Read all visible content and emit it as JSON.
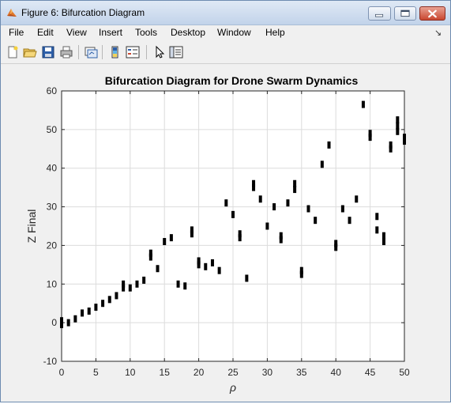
{
  "window": {
    "title": "Figure 6: Bifurcation Diagram",
    "icon": "matlab-figure-icon",
    "title_bar_color": "#c2d3ea",
    "close_color": "#c94730"
  },
  "menu": [
    "File",
    "Edit",
    "View",
    "Insert",
    "Tools",
    "Desktop",
    "Window",
    "Help"
  ],
  "toolbar_icons": [
    "new-figure-icon",
    "open-file-icon",
    "save-icon",
    "print-icon",
    "link-plot-icon",
    "insert-colorbar-icon",
    "insert-legend-icon",
    "edit-plot-arrow-icon",
    "property-editor-icon"
  ],
  "chart_data": {
    "type": "scatter",
    "title": "Bifurcation Diagram for Drone Swarm Dynamics",
    "xlabel": "ρ",
    "ylabel": "Z Final",
    "xlim": [
      0,
      50
    ],
    "ylim": [
      -10,
      60
    ],
    "xticks": [
      "0",
      "5",
      "10",
      "15",
      "20",
      "25",
      "30",
      "35",
      "40",
      "45",
      "50"
    ],
    "yticks": [
      "-10",
      "0",
      "10",
      "20",
      "30",
      "40",
      "50",
      "60"
    ],
    "grid": true,
    "marker": "short vertical dark segments",
    "marker_color": "#000000",
    "points": [
      [
        0,
        -0.5
      ],
      [
        0,
        0.5
      ],
      [
        1,
        0
      ],
      [
        2,
        1
      ],
      [
        3,
        2.5
      ],
      [
        4,
        3
      ],
      [
        5,
        4
      ],
      [
        6,
        5
      ],
      [
        7,
        6
      ],
      [
        8,
        7
      ],
      [
        9,
        9
      ],
      [
        9,
        10
      ],
      [
        10,
        9
      ],
      [
        11,
        10
      ],
      [
        12,
        11
      ],
      [
        13,
        17
      ],
      [
        13,
        18
      ],
      [
        14,
        14
      ],
      [
        15,
        21
      ],
      [
        16,
        22
      ],
      [
        17,
        10
      ],
      [
        18,
        9.5
      ],
      [
        19,
        23
      ],
      [
        19,
        24
      ],
      [
        20,
        15
      ],
      [
        20,
        16
      ],
      [
        21,
        14.5
      ],
      [
        22,
        15.5
      ],
      [
        23,
        13.5
      ],
      [
        24,
        31
      ],
      [
        25,
        28
      ],
      [
        26,
        22
      ],
      [
        26,
        23
      ],
      [
        27,
        11.5
      ],
      [
        28,
        35
      ],
      [
        28,
        36
      ],
      [
        29,
        32
      ],
      [
        30,
        25
      ],
      [
        31,
        30
      ],
      [
        32,
        21.5
      ],
      [
        32,
        22.5
      ],
      [
        33,
        31
      ],
      [
        34,
        34.5
      ],
      [
        34,
        36
      ],
      [
        35,
        12.5
      ],
      [
        35,
        13.5
      ],
      [
        36,
        29.5
      ],
      [
        37,
        26.5
      ],
      [
        38,
        41
      ],
      [
        39,
        46
      ],
      [
        40,
        19.5
      ],
      [
        40,
        20.5
      ],
      [
        41,
        29.5
      ],
      [
        42,
        26.5
      ],
      [
        43,
        32
      ],
      [
        44,
        56.5
      ],
      [
        45,
        48
      ],
      [
        45,
        49
      ],
      [
        46,
        27.5
      ],
      [
        46,
        24
      ],
      [
        47,
        21
      ],
      [
        47,
        22.5
      ],
      [
        48,
        45
      ],
      [
        48,
        46
      ],
      [
        49,
        49.5
      ],
      [
        49,
        51
      ],
      [
        49,
        52.5
      ],
      [
        50,
        47
      ],
      [
        50,
        48
      ]
    ]
  }
}
